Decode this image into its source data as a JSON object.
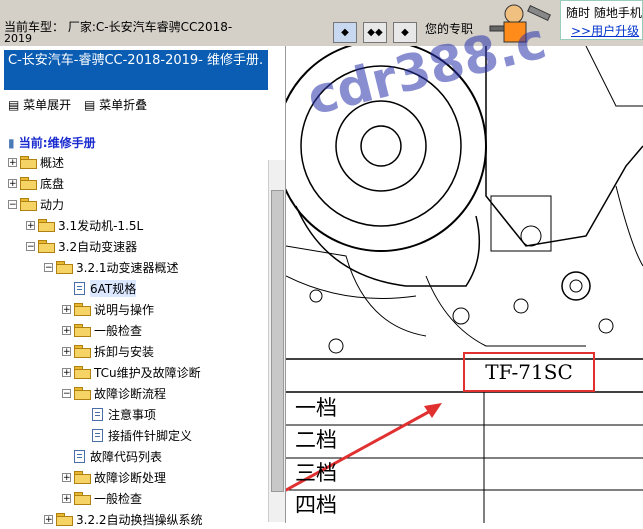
{
  "topbar": {
    "model_label": "当前车型：  厂家:C-长安汽车睿骋CC2018-",
    "model_label_cont": "2019",
    "nav_first": "◆",
    "nav_split": "◆◆",
    "nav_last": "◆",
    "promo_text": "您的专职",
    "promo_line1": "随时 随地手机",
    "promo_link": ">>用户升级"
  },
  "left": {
    "doc_title": "C-长安汽车-睿骋CC-2018-2019- 维修手册.",
    "menu_expand": "菜单展开",
    "menu_collapse": "菜单折叠",
    "current": "当前:维修手册",
    "tree": [
      {
        "label": "概述",
        "type": "folder",
        "expanded": false
      },
      {
        "label": "底盘",
        "type": "folder",
        "expanded": false
      },
      {
        "label": "动力",
        "type": "folder",
        "expanded": true
      },
      {
        "label": "3.1发动机-1.5L",
        "type": "folder",
        "expanded": false
      },
      {
        "label": "3.2自动变速器",
        "type": "folder",
        "expanded": true
      },
      {
        "label": "3.2.1动变速器概述",
        "type": "folder",
        "expanded": true
      },
      {
        "label": "6AT规格",
        "type": "page",
        "selected": true
      },
      {
        "label": "说明与操作",
        "type": "folder",
        "expanded": false
      },
      {
        "label": "一般检查",
        "type": "folder",
        "expanded": false
      },
      {
        "label": "拆卸与安装",
        "type": "folder",
        "expanded": false
      },
      {
        "label": "TCu维护及故障诊断",
        "type": "folder",
        "expanded": false
      },
      {
        "label": "故障诊断流程",
        "type": "folder",
        "expanded": true
      },
      {
        "label": "注意事项",
        "type": "page"
      },
      {
        "label": "接插件针脚定义",
        "type": "page"
      },
      {
        "label": "故障代码列表",
        "type": "page"
      },
      {
        "label": "故障诊断处理",
        "type": "folder",
        "expanded": false
      },
      {
        "label": "一般检查",
        "type": "folder",
        "expanded": false
      },
      {
        "label": "3.2.2自动换挡操纵系统",
        "type": "folder",
        "expanded": false
      }
    ]
  },
  "document": {
    "watermark": "cdr388.c",
    "table_header": "TF-71SC",
    "gears": [
      "一档",
      "二档",
      "三档",
      "四档"
    ]
  },
  "colors": {
    "title_bg": "#0a5db3",
    "highlight": "#e03030",
    "link": "#0033cc"
  }
}
